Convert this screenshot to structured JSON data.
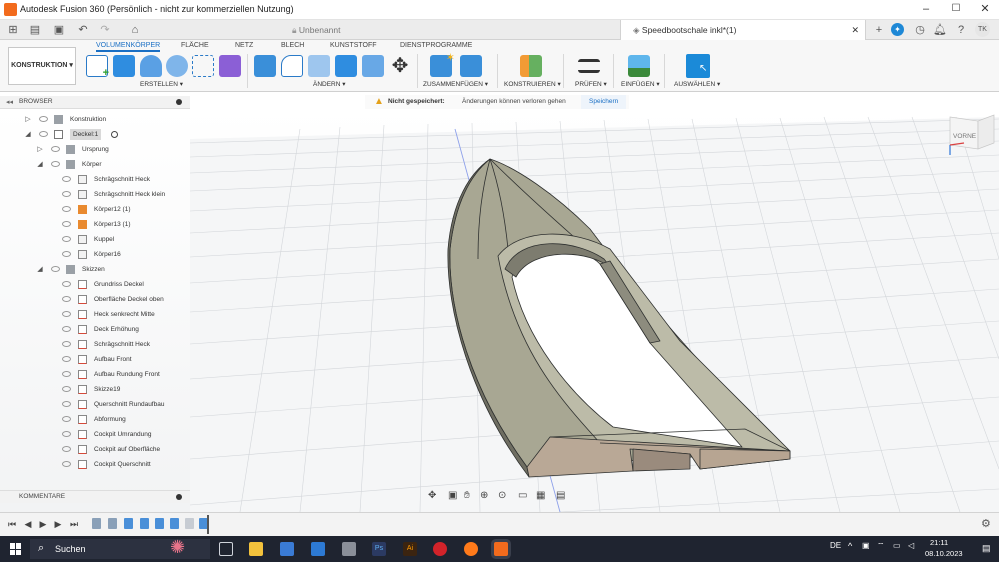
{
  "window": {
    "title": "Autodesk Fusion 360 (Persönlich - nicht zur kommerziellen Nutzung)",
    "minimize": "–",
    "maximize": "☐",
    "close": "✕"
  },
  "tabs": [
    {
      "label": "Unbenannt",
      "active": false
    },
    {
      "label": "Speedbootschale inkl*(1)",
      "active": true
    }
  ],
  "tab_close": "✕",
  "user_initials": "TK",
  "workspace": "KONSTRUKTION ▾",
  "ribbon_tabs": [
    "VOLUMENKÖRPER",
    "FLÄCHE",
    "NETZ",
    "BLECH",
    "KUNSTSTOFF",
    "DIENSTPROGRAMME"
  ],
  "ribbon_groups": [
    "ERSTELLEN ▾",
    "ÄNDERN ▾",
    "ZUSAMMENFÜGEN ▾",
    "KONSTRUIEREN ▾",
    "PRÜFEN ▾",
    "EINFÜGEN ▾",
    "AUSWÄHLEN ▾"
  ],
  "browser": {
    "title": "BROWSER",
    "items": [
      {
        "label": "Konstruktion",
        "level": 1,
        "type": "folder",
        "tri": "▷"
      },
      {
        "label": "Deckel:1",
        "level": 1,
        "type": "component",
        "tri": "◢"
      },
      {
        "label": "Ursprung",
        "level": 2,
        "type": "folder",
        "tri": "▷"
      },
      {
        "label": "Körper",
        "level": 2,
        "type": "folder",
        "tri": "◢"
      },
      {
        "label": "Schrägschnitt Heck",
        "level": 3,
        "type": "body"
      },
      {
        "label": "Schrägschnitt Heck klein",
        "level": 3,
        "type": "body"
      },
      {
        "label": "Körper12 (1)",
        "level": 3,
        "type": "body-orange"
      },
      {
        "label": "Körper13 (1)",
        "level": 3,
        "type": "body-orange"
      },
      {
        "label": "Kuppel",
        "level": 3,
        "type": "body"
      },
      {
        "label": "Körper16",
        "level": 3,
        "type": "body"
      },
      {
        "label": "Skizzen",
        "level": 2,
        "type": "folder",
        "tri": "◢"
      },
      {
        "label": "Grundriss Deckel",
        "level": 3,
        "type": "sketch"
      },
      {
        "label": "Oberfläche Deckel oben",
        "level": 3,
        "type": "sketch"
      },
      {
        "label": "Heck senkrecht Mitte",
        "level": 3,
        "type": "sketch"
      },
      {
        "label": "Deck Erhöhung",
        "level": 3,
        "type": "sketch"
      },
      {
        "label": "Schrägschnitt Heck",
        "level": 3,
        "type": "sketch"
      },
      {
        "label": "Aufbau Front",
        "level": 3,
        "type": "sketch"
      },
      {
        "label": "Aufbau Rundung Front",
        "level": 3,
        "type": "sketch"
      },
      {
        "label": "Skizze19",
        "level": 3,
        "type": "sketch"
      },
      {
        "label": "Querschnitt Rundaufbau",
        "level": 3,
        "type": "sketch"
      },
      {
        "label": "Abformung",
        "level": 3,
        "type": "sketch"
      },
      {
        "label": "Cockpit Umrandung",
        "level": 3,
        "type": "sketch"
      },
      {
        "label": "Cockpit auf Oberfläche",
        "level": 3,
        "type": "sketch"
      },
      {
        "label": "Cockpit Querschnitt",
        "level": 3,
        "type": "sketch"
      }
    ]
  },
  "notice": {
    "title": "Nicht gespeichert:",
    "message": "Änderungen können verloren gehen",
    "action": "Speichern"
  },
  "viewcube_label": "VORNE",
  "comments_title": "KOMMENTARE",
  "taskbar": {
    "search": "Suchen",
    "lang": "DE",
    "time": "21:11",
    "date": "08.10.2023"
  },
  "colors": {
    "accent": "#1a6fc4",
    "select_active": "#1b8ad8",
    "hull_top": "#a9a895",
    "taskbar": "#1f2430"
  }
}
